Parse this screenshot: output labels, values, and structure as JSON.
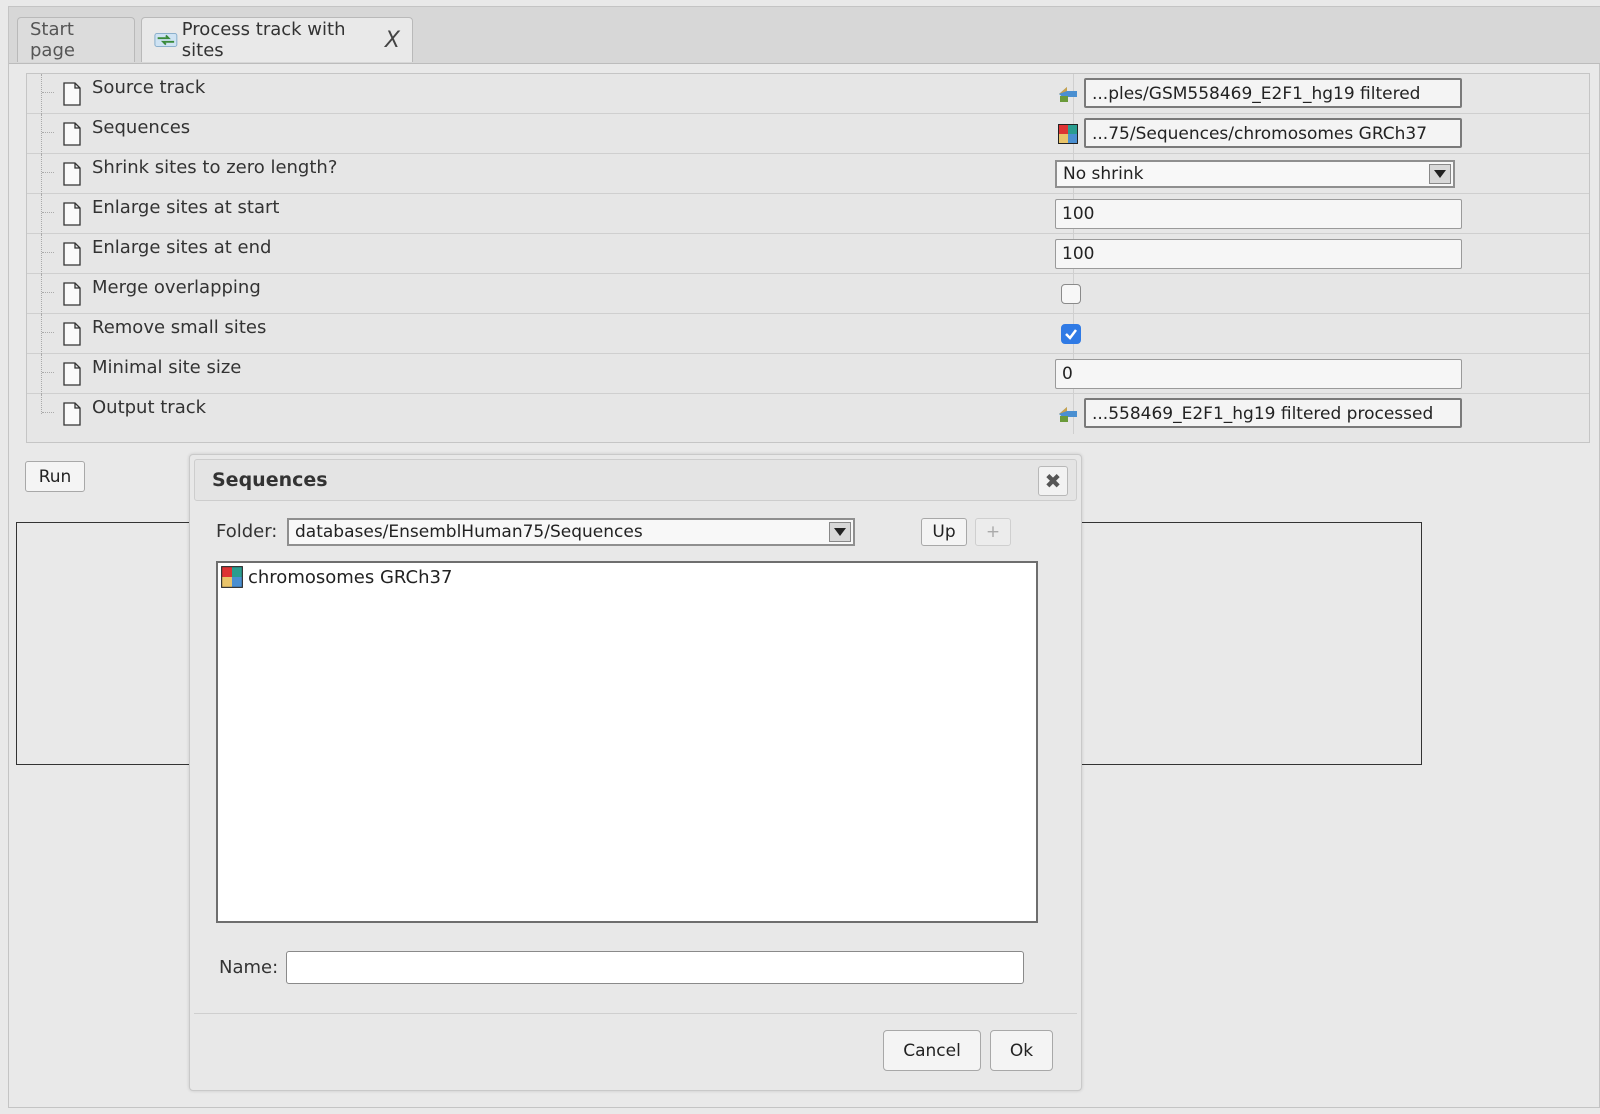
{
  "tabs": [
    {
      "label": "Start page"
    },
    {
      "label": "Process track with sites",
      "close": "X"
    }
  ],
  "properties": [
    {
      "label": "Source track",
      "value": "...ples/GSM558469_E2F1_hg19 filtered"
    },
    {
      "label": "Sequences",
      "value": "...75/Sequences/chromosomes GRCh37"
    },
    {
      "label": "Shrink sites to zero length?",
      "value": "No shrink"
    },
    {
      "label": "Enlarge sites at start",
      "value": "100"
    },
    {
      "label": "Enlarge sites at end",
      "value": "100"
    },
    {
      "label": "Merge overlapping",
      "checked": false
    },
    {
      "label": "Remove small sites",
      "checked": true
    },
    {
      "label": "Minimal site size",
      "value": "0"
    },
    {
      "label": "Output track",
      "value": "...558469_E2F1_hg19 filtered processed"
    }
  ],
  "run_label": "Run",
  "dialog": {
    "title": "Sequences",
    "close_glyph": "✖",
    "folder_label": "Folder:",
    "folder_value": "databases/EnsemblHuman75/Sequences",
    "up_label": "Up",
    "new_label": "+",
    "items": [
      "chromosomes GRCh37"
    ],
    "name_label": "Name:",
    "name_value": "",
    "cancel_label": "Cancel",
    "ok_label": "Ok"
  },
  "colors": {
    "checkbox_checked": "#2f7ae5",
    "background": "#e9e9e9"
  }
}
